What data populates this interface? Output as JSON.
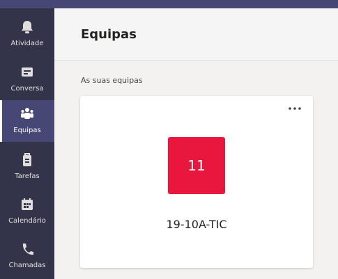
{
  "app_rail": {
    "items": [
      {
        "label": "Atividade",
        "icon": "bell-icon"
      },
      {
        "label": "Conversa",
        "icon": "chat-icon"
      },
      {
        "label": "Equipas",
        "icon": "teams-icon",
        "active": true
      },
      {
        "label": "Tarefas",
        "icon": "tasks-icon"
      },
      {
        "label": "Calendário",
        "icon": "calendar-icon"
      },
      {
        "label": "Chamadas",
        "icon": "phone-icon"
      }
    ]
  },
  "header": {
    "title": "Equipas"
  },
  "main": {
    "section_label": "As suas equipas",
    "teams": [
      {
        "avatar_text": "11",
        "name": "19-10A-TIC",
        "avatar_color": "#e9173e",
        "more_icon": "more-options-icon"
      }
    ]
  },
  "colors": {
    "rail_background": "#33344a",
    "rail_active": "#464775",
    "page_background": "#f3f2f1",
    "team_avatar": "#e9173e"
  }
}
